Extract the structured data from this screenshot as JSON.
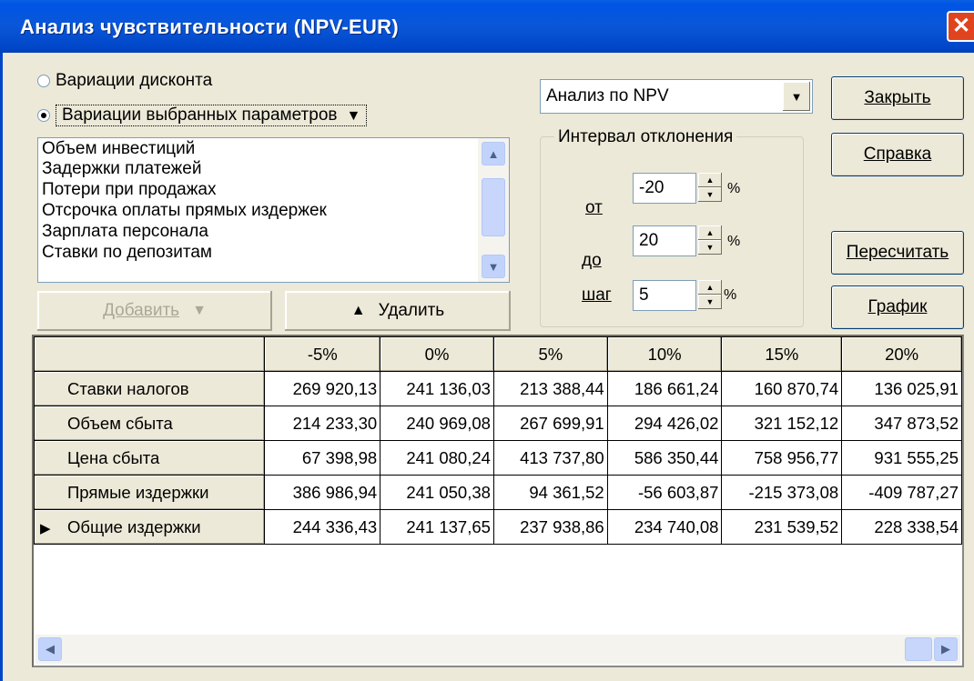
{
  "window": {
    "title": "Анализ чувствительности (NPV-EUR)",
    "close_glyph": "✕"
  },
  "mode": {
    "option1": "Вариации дисконта",
    "option2": "Вариации выбранных параметров",
    "selected": "option2"
  },
  "param_list": {
    "items": [
      "Объем инвестиций",
      "Задержки платежей",
      "Потери при продажах",
      "Отсрочка оплаты прямых издержек",
      "Зарплата персонала",
      "Ставки по депозитам"
    ]
  },
  "buttons": {
    "add": "Добавить",
    "remove": "Удалить",
    "close": "Закрыть",
    "help": "Справка",
    "recalc": "Пересчитать",
    "chart": "График"
  },
  "analysis_select": {
    "value": "Анализ по NPV"
  },
  "interval": {
    "label": "Интервал отклонения",
    "from_label": "от",
    "from_value": "-20",
    "to_label": "до",
    "to_value": "20",
    "step_label": "шаг",
    "step_value": "5",
    "unit": "%"
  },
  "table": {
    "columns": [
      "",
      "-5%",
      "0%",
      "5%",
      "10%",
      "15%",
      "20%"
    ],
    "rows": [
      {
        "label": "Ставки налогов",
        "values": [
          "269 920,13",
          "241 136,03",
          "213 388,44",
          "186 661,24",
          "160 870,74",
          "136 025,91"
        ]
      },
      {
        "label": "Объем сбыта",
        "values": [
          "214 233,30",
          "240 969,08",
          "267 699,91",
          "294 426,02",
          "321 152,12",
          "347 873,52"
        ]
      },
      {
        "label": "Цена сбыта",
        "values": [
          "67 398,98",
          "241 080,24",
          "413 737,80",
          "586 350,44",
          "758 956,77",
          "931 555,25"
        ]
      },
      {
        "label": "Прямые издержки",
        "values": [
          "386 986,94",
          "241 050,38",
          "94 361,52",
          "-56 603,87",
          "-215 373,08",
          "-409 787,27"
        ]
      },
      {
        "label": "Общие издержки",
        "values": [
          "244 336,43",
          "241 137,65",
          "237 938,86",
          "234 740,08",
          "231 539,52",
          "228 338,54"
        ]
      }
    ],
    "current_row_marker": "▶"
  }
}
